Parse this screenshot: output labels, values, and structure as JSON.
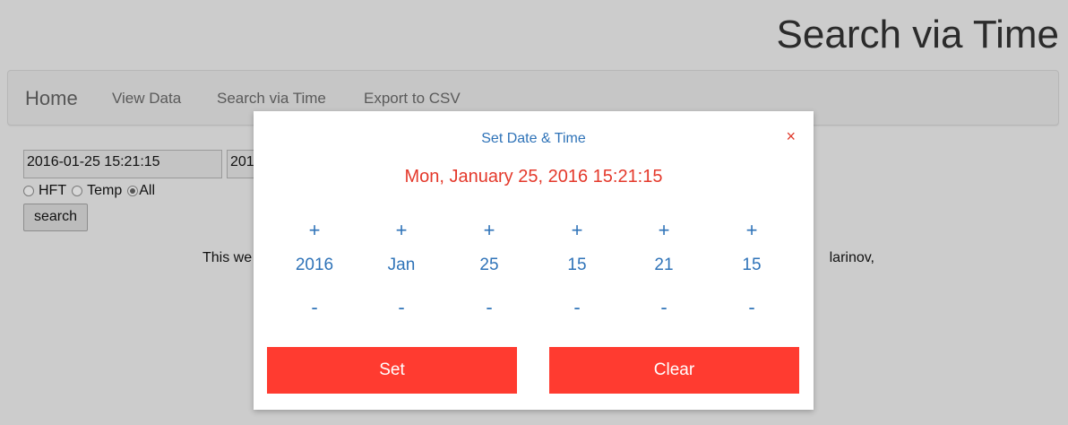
{
  "header": {
    "title": "Search via Time"
  },
  "nav": {
    "brand": "Home",
    "links": [
      "View Data",
      "Search via Time",
      "Export to CSV"
    ]
  },
  "form": {
    "from_value": "2016-01-25 15:21:15",
    "to_value_visible": "201",
    "radios": [
      {
        "label": "HFT",
        "checked": false
      },
      {
        "label": "Temp",
        "checked": false
      },
      {
        "label": "All",
        "checked": true
      }
    ],
    "search_label": "search"
  },
  "footer": {
    "left_fragment": "This we",
    "right_fragment": "larinov,"
  },
  "modal": {
    "title": "Set Date & Time",
    "close": "×",
    "datetime": "Mon, January 25, 2016 15:21:15",
    "plus": "+",
    "minus": "-",
    "columns": [
      "2016",
      "Jan",
      "25",
      "15",
      "21",
      "15"
    ],
    "set_label": "Set",
    "clear_label": "Clear"
  },
  "colors": {
    "accent_blue": "#2f73b8",
    "accent_red": "#ff3b30",
    "background": "#cccccc"
  }
}
